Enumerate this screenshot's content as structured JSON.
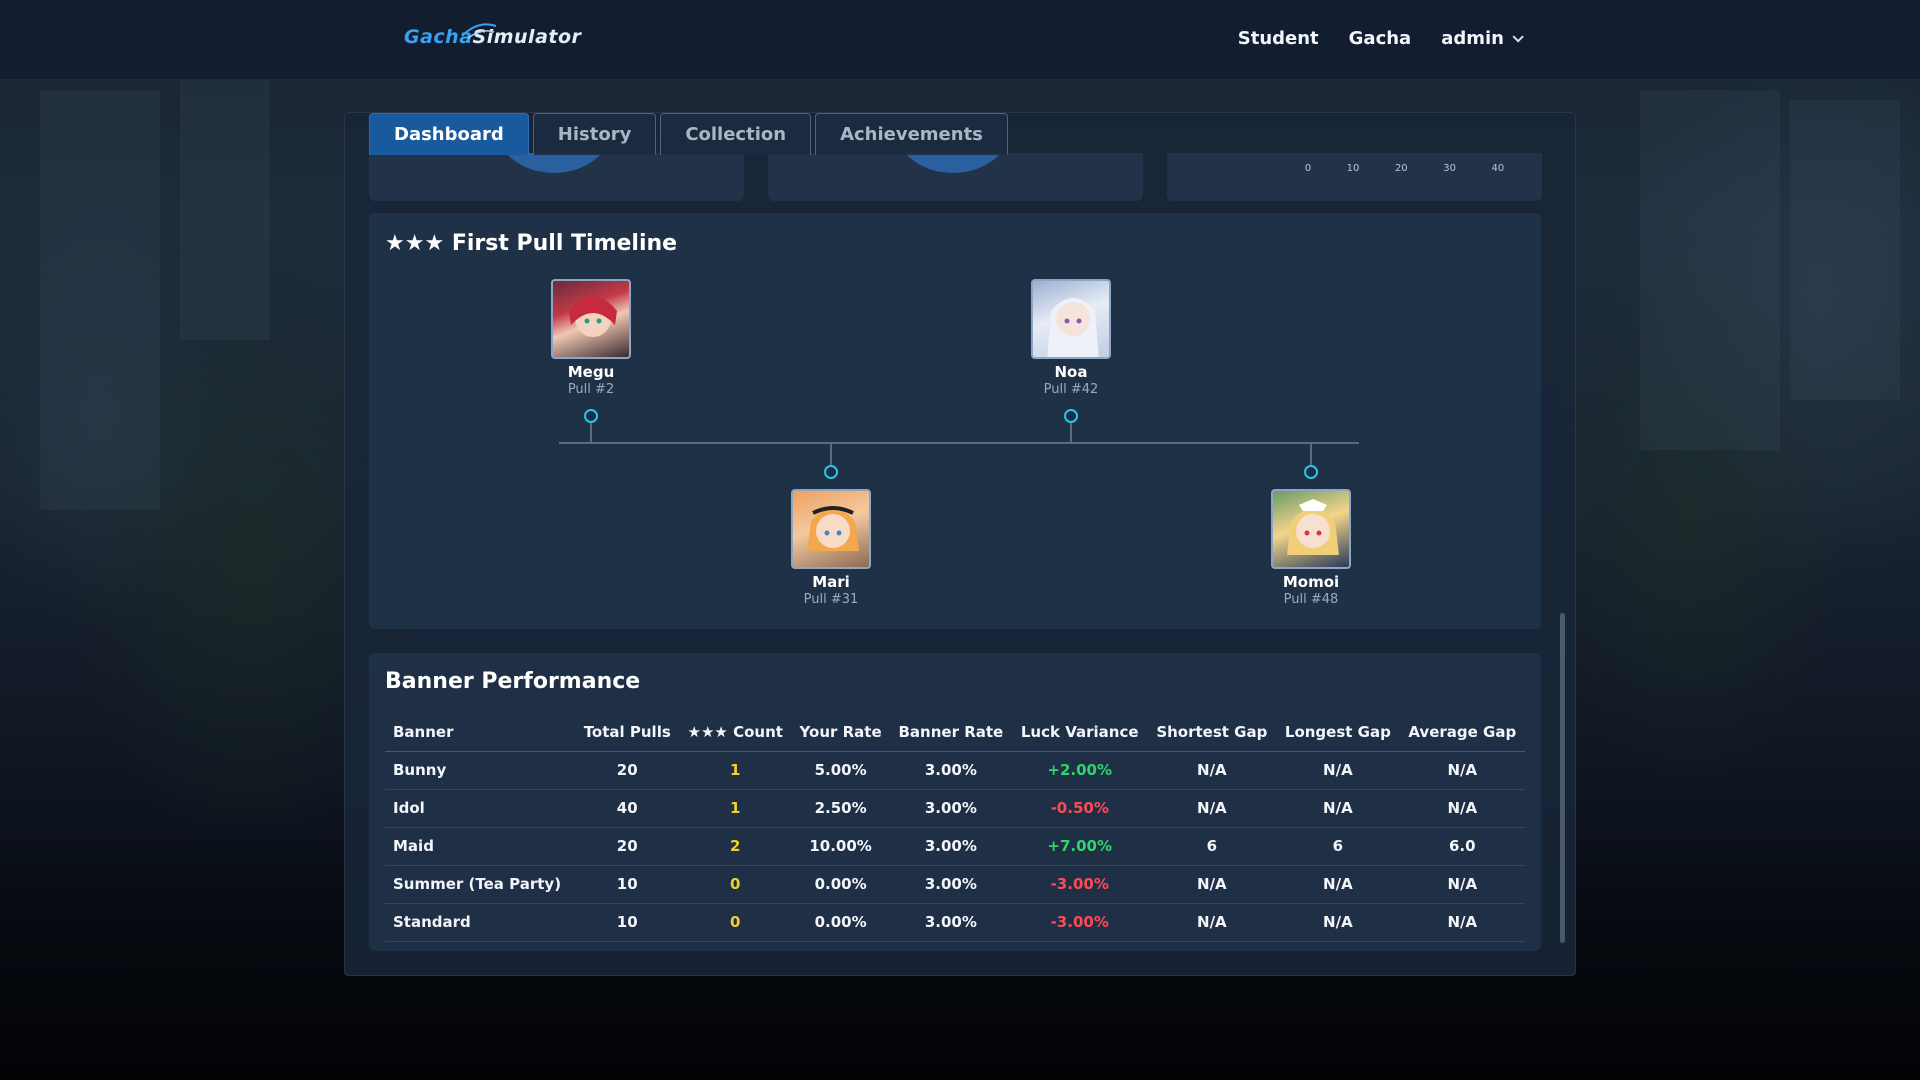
{
  "header": {
    "logo_part1": "Gacha",
    "logo_part2": "Simulator",
    "nav": {
      "student": "Student",
      "gacha": "Gacha",
      "user": "admin"
    }
  },
  "tabs": [
    "Dashboard",
    "History",
    "Collection",
    "Achievements"
  ],
  "top_axis_ticks": [
    "0",
    "10",
    "20",
    "30",
    "40"
  ],
  "timeline": {
    "title": "★★★ First Pull Timeline",
    "entries": [
      {
        "name": "Megu",
        "pull": "Pull #2"
      },
      {
        "name": "Mari",
        "pull": "Pull #31"
      },
      {
        "name": "Noa",
        "pull": "Pull #42"
      },
      {
        "name": "Momoi",
        "pull": "Pull #48"
      }
    ]
  },
  "banner_performance": {
    "title": "Banner Performance",
    "columns": [
      "Banner",
      "Total Pulls",
      "★★★ Count",
      "Your Rate",
      "Banner Rate",
      "Luck Variance",
      "Shortest Gap",
      "Longest Gap",
      "Average Gap"
    ],
    "rows": [
      [
        "Bunny",
        "20",
        "1",
        "5.00%",
        "3.00%",
        "+2.00%",
        "N/A",
        "N/A",
        "N/A"
      ],
      [
        "Idol",
        "40",
        "1",
        "2.50%",
        "3.00%",
        "-0.50%",
        "N/A",
        "N/A",
        "N/A"
      ],
      [
        "Maid",
        "20",
        "2",
        "10.00%",
        "3.00%",
        "+7.00%",
        "6",
        "6",
        "6.0"
      ],
      [
        "Summer (Tea Party)",
        "10",
        "0",
        "0.00%",
        "3.00%",
        "-3.00%",
        "N/A",
        "N/A",
        "N/A"
      ],
      [
        "Standard",
        "10",
        "0",
        "0.00%",
        "3.00%",
        "-3.00%",
        "N/A",
        "N/A",
        "N/A"
      ]
    ]
  },
  "colors": {
    "accent": "#19599e",
    "positive": "#2fd56a",
    "negative": "#ff4a55",
    "count": "#f2d02c",
    "timeline_dot": "#25c4e8"
  }
}
